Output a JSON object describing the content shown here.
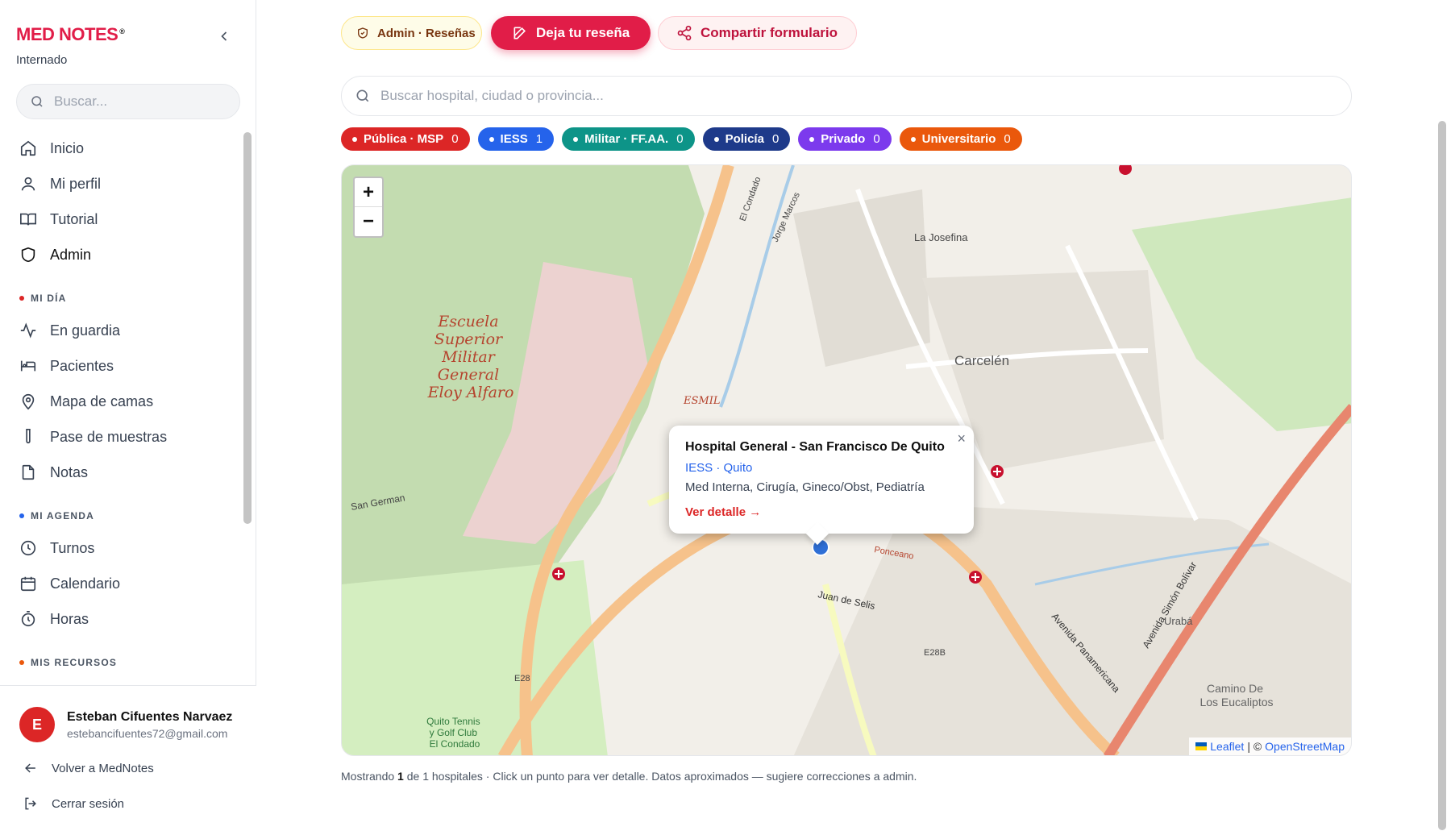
{
  "brand": {
    "name": "MED NOTES",
    "mark": "®",
    "subtitle": "Internado"
  },
  "sidebar": {
    "search_placeholder": "Buscar...",
    "main_items": [
      {
        "label": "Inicio",
        "icon": "home-icon"
      },
      {
        "label": "Mi perfil",
        "icon": "user-icon"
      },
      {
        "label": "Tutorial",
        "icon": "book-open-icon"
      },
      {
        "label": "Admin",
        "icon": "shield-icon",
        "active": true
      }
    ],
    "sections": [
      {
        "title": "MI DÍA",
        "color": "#dc2626",
        "items": [
          {
            "label": "En guardia",
            "icon": "activity-icon"
          },
          {
            "label": "Pacientes",
            "icon": "bed-icon"
          },
          {
            "label": "Mapa de camas",
            "icon": "map-pin-icon"
          },
          {
            "label": "Pase de muestras",
            "icon": "test-tube-icon"
          },
          {
            "label": "Notas",
            "icon": "file-icon"
          }
        ]
      },
      {
        "title": "MI AGENDA",
        "color": "#2563eb",
        "items": [
          {
            "label": "Turnos",
            "icon": "clock-icon"
          },
          {
            "label": "Calendario",
            "icon": "calendar-icon"
          },
          {
            "label": "Horas",
            "icon": "timer-icon"
          }
        ]
      },
      {
        "title": "MIS RECURSOS",
        "color": "#ea580c",
        "items": []
      }
    ],
    "user": {
      "initial": "E",
      "name": "Esteban Cifuentes Narvaez",
      "email": "estebancifuentes72@gmail.com"
    },
    "back_label": "Volver a MedNotes",
    "logout_label": "Cerrar sesión"
  },
  "toolbar": {
    "admin_label": "Admin · Reseñas",
    "review_label": "Deja tu reseña",
    "share_label": "Compartir formulario"
  },
  "map_search_placeholder": "Buscar hospital, ciudad o provincia...",
  "filters": [
    {
      "label": "Pública · MSP",
      "count": "0",
      "color": "#dc2626"
    },
    {
      "label": "IESS",
      "count": "1",
      "color": "#2563eb"
    },
    {
      "label": "Militar · FF.AA.",
      "count": "0",
      "color": "#0d9488"
    },
    {
      "label": "Policía",
      "count": "0",
      "color": "#1e3a8a"
    },
    {
      "label": "Privado",
      "count": "0",
      "color": "#7c3aed"
    },
    {
      "label": "Universitario",
      "count": "0",
      "color": "#ea580c"
    }
  ],
  "map": {
    "zoom_in": "+",
    "zoom_out": "−",
    "popup": {
      "title": "Hospital General - San Francisco De Quito",
      "meta": "IESS · Quito",
      "specialties": "Med Interna, Cirugía, Gineco/Obst, Pediatría",
      "link": "Ver detalle →",
      "close": "×"
    },
    "labels": {
      "escuela": [
        "Escuela",
        "Superior",
        "Militar",
        "General",
        "Eloy Alfaro"
      ],
      "carcelen": "Carcelén",
      "esmil": "ESMIL",
      "josefina": "La Josefina",
      "golf": [
        "Quito Tennis",
        "y Golf Club",
        "El Condado"
      ],
      "camino": [
        "Camino De",
        "Los Eucaliptos"
      ],
      "av_simon": "Avenida Simón Bolívar",
      "av_pana": "Avenida Panamericana",
      "uraba": "Urabá",
      "san_german": "San German",
      "e28": "E28",
      "e28b": "E28B",
      "condado": "El Condado",
      "jorge": "Jorge Marcos",
      "juan_selis": "Juan de Selis",
      "ponceano": "Ponceano"
    },
    "attribution": {
      "leaflet": "Leaflet",
      "sep": "| ©",
      "osm": "OpenStreetMap"
    }
  },
  "footnote": {
    "prefix": "Mostrando",
    "shown": "1",
    "mid": "de 1 hospitales · Click un punto para ver detalle. Datos aproximados — sugiere correcciones a admin."
  },
  "colors": {
    "accent": "#e11d48",
    "iess_marker": "#2f6fd6",
    "hospital_marker": "#c8102e"
  }
}
